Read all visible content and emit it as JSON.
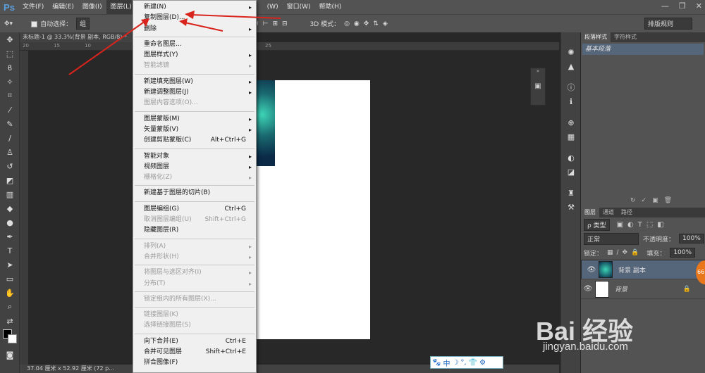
{
  "app": {
    "logo": "Ps"
  },
  "menubar": {
    "items": [
      "文件(F)",
      "编辑(E)",
      "图像(I)",
      "图层(L)",
      "(W)",
      "窗口(W)",
      "帮助(H)"
    ]
  },
  "window_controls": {
    "minimize": "—",
    "restore": "❐",
    "close": "✕"
  },
  "options": {
    "auto_select_label": "自动选择：",
    "auto_select_value": "组",
    "mode_3d_label": "3D 模式：",
    "workspace": "排版规则"
  },
  "document": {
    "tab_title": "未标题-1 @ 33.3%(背景 副本, RGB/8) *",
    "status": "37.04 厘米 x 52.92 厘米 (72 p..."
  },
  "rulers": {
    "top_ticks": [
      "20",
      "15",
      "10",
      "25"
    ]
  },
  "layer_menu": {
    "groups": [
      [
        {
          "label": "新建(N)",
          "sub": true
        },
        {
          "label": "复制图层(D)..."
        },
        {
          "label": "删除",
          "sub": true
        }
      ],
      [
        {
          "label": "重命名图层..."
        },
        {
          "label": "图层样式(Y)",
          "sub": true
        },
        {
          "label": "智能滤镜",
          "disabled": true,
          "sub": true
        }
      ],
      [
        {
          "label": "新建填充图层(W)",
          "sub": true
        },
        {
          "label": "新建调整图层(J)",
          "sub": true
        },
        {
          "label": "图层内容选项(O)...",
          "disabled": true
        }
      ],
      [
        {
          "label": "图层蒙版(M)",
          "sub": true
        },
        {
          "label": "矢量蒙版(V)",
          "sub": true
        },
        {
          "label": "创建剪贴蒙版(C)",
          "shortcut": "Alt+Ctrl+G"
        }
      ],
      [
        {
          "label": "智能对象",
          "sub": true
        },
        {
          "label": "视频图层",
          "sub": true
        },
        {
          "label": "栅格化(Z)",
          "disabled": true,
          "sub": true
        }
      ],
      [
        {
          "label": "新建基于图层的切片(B)"
        }
      ],
      [
        {
          "label": "图层编组(G)",
          "shortcut": "Ctrl+G"
        },
        {
          "label": "取消图层编组(U)",
          "shortcut": "Shift+Ctrl+G",
          "disabled": true
        },
        {
          "label": "隐藏图层(R)"
        }
      ],
      [
        {
          "label": "排列(A)",
          "disabled": true,
          "sub": true
        },
        {
          "label": "合并形状(H)",
          "disabled": true,
          "sub": true
        }
      ],
      [
        {
          "label": "将图层与选区对齐(I)",
          "disabled": true,
          "sub": true
        },
        {
          "label": "分布(T)",
          "disabled": true,
          "sub": true
        }
      ],
      [
        {
          "label": "锁定组内的所有图层(X)...",
          "disabled": true
        }
      ],
      [
        {
          "label": "链接图层(K)",
          "disabled": true
        },
        {
          "label": "选择链接图层(S)",
          "disabled": true
        }
      ],
      [
        {
          "label": "向下合并(E)",
          "shortcut": "Ctrl+E"
        },
        {
          "label": "合并可见图层",
          "shortcut": "Shift+Ctrl+E"
        },
        {
          "label": "拼合图像(F)"
        }
      ]
    ]
  },
  "para_panel": {
    "tabs": [
      "段落样式",
      "字符样式"
    ],
    "item": "基本段落"
  },
  "layers_panel": {
    "tabs": [
      "图层",
      "通道",
      "路径"
    ],
    "filter": "ρ 类型",
    "blend_mode": "正常",
    "opacity_label": "不透明度：",
    "opacity": "100%",
    "lock_label": "锁定：",
    "fill_label": "填充：",
    "fill": "100%",
    "layers": [
      {
        "name": "背景 副本",
        "selected": true
      },
      {
        "name": "背景",
        "selected": false
      }
    ]
  },
  "ime": {
    "label": "中"
  },
  "watermark": {
    "brand": "Bai 经验",
    "url": "jingyan.baidu.com"
  },
  "badge": {
    "text": "66"
  },
  "colors": {
    "arrow": "#d8241c",
    "selection": "#55657a"
  }
}
